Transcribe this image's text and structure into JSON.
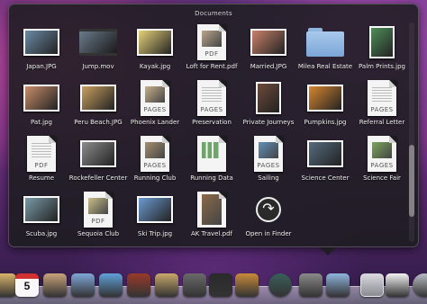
{
  "stack": {
    "title": "Documents",
    "items": [
      {
        "label": "Japan.JPG",
        "kind": "photo-land",
        "color": "#6b8aa6"
      },
      {
        "label": "Jump.mov",
        "kind": "movie",
        "color": "#3a3a3a"
      },
      {
        "label": "Kayak.jpg",
        "kind": "photo-land",
        "color": "#e6d27a"
      },
      {
        "label": "Loft for Rent.pdf",
        "kind": "pdf-photo",
        "color": "#b9a58c",
        "type": "PDF"
      },
      {
        "label": "Married.JPG",
        "kind": "photo-land",
        "color": "#c9826a"
      },
      {
        "label": "Milea Real Estate",
        "kind": "folder",
        "color": "#8fb5de"
      },
      {
        "label": "Palm Prints.jpg",
        "kind": "photo-port",
        "color": "#4e8f5a"
      },
      {
        "label": "Pat.jpg",
        "kind": "photo-land",
        "color": "#c88d6a"
      },
      {
        "label": "Peru Beach.JPG",
        "kind": "photo-land",
        "color": "#c9a060"
      },
      {
        "label": "Phoenix Lander",
        "kind": "pages",
        "color": "#c7b08a",
        "type": "PAGES"
      },
      {
        "label": "Preservation",
        "kind": "pages-text",
        "color": "#9a9a9a",
        "type": "PAGES"
      },
      {
        "label": "Private Journeys",
        "kind": "photo-port",
        "color": "#6d4a3b"
      },
      {
        "label": "Pumpkins.jpg",
        "kind": "photo-land",
        "color": "#d6862f"
      },
      {
        "label": "Referral Letter",
        "kind": "pages-text",
        "color": "#9a9a9a",
        "type": "PAGES"
      },
      {
        "label": "Resume",
        "kind": "pdf-text",
        "color": "#9a9a9a",
        "type": "PDF"
      },
      {
        "label": "Rockefeller Center",
        "kind": "photo-land",
        "color": "#8c8c8c"
      },
      {
        "label": "Running Club",
        "kind": "pages",
        "color": "#a49070",
        "type": "PAGES"
      },
      {
        "label": "Running Data",
        "kind": "chart-doc",
        "color": "#6fa46a"
      },
      {
        "label": "Sailing",
        "kind": "pages",
        "color": "#5f8fb8",
        "type": "PAGES"
      },
      {
        "label": "Science Center",
        "kind": "photo-land",
        "color": "#556b7d"
      },
      {
        "label": "Science Fair",
        "kind": "pages",
        "color": "#7aa65a",
        "type": "PAGES"
      },
      {
        "label": "Scuba.jpg",
        "kind": "photo-land",
        "color": "#7a9aa8"
      },
      {
        "label": "Sequoia Club",
        "kind": "pdf-photo",
        "color": "#c9c08a",
        "type": "PDF"
      },
      {
        "label": "Ski Trip.jpg",
        "kind": "photo-land",
        "color": "#6b9ad0"
      },
      {
        "label": "AK Travel.pdf",
        "kind": "ak-doc",
        "color": "#8a6a4a"
      },
      {
        "label": "Open in Finder",
        "kind": "finder",
        "color": "#2a2a2a"
      }
    ]
  },
  "dock": {
    "calendar_day": "5",
    "icons": [
      {
        "name": "notes-dock-icon",
        "color": "#d9b56a"
      },
      {
        "name": "calendar-dock-icon",
        "color": "#f4f4f4"
      },
      {
        "name": "address-book-dock-icon",
        "color": "#c9a37a"
      },
      {
        "name": "mail-dock-icon",
        "color": "#7fa7d8"
      },
      {
        "name": "itunes-dock-icon",
        "color": "#5fa0d8"
      },
      {
        "name": "photo-booth-dock-icon",
        "color": "#9a3a2a"
      },
      {
        "name": "iphoto-dock-icon",
        "color": "#c9a86a"
      },
      {
        "name": "iwork-dock-icon",
        "color": "#6a6a6a"
      },
      {
        "name": "star-dock-icon",
        "color": "#2a2a2a"
      },
      {
        "name": "garageband-dock-icon",
        "color": "#c98a3a"
      },
      {
        "name": "time-machine-dock-icon",
        "color": "#3a5f5a"
      },
      {
        "name": "system-preferences-dock-icon",
        "color": "#8a8a8a"
      },
      {
        "name": "applications-folder-dock-icon",
        "color": "#8fb5de"
      },
      {
        "name": "documents-stack-dock-icon",
        "color": "#a0a0a8"
      },
      {
        "name": "downloads-stack-dock-icon",
        "color": "#f2f2f2"
      },
      {
        "name": "trash-dock-icon",
        "color": "#b8bcc4"
      }
    ]
  }
}
